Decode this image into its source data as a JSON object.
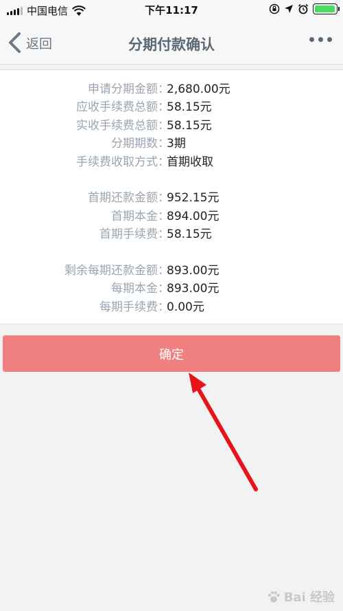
{
  "status_bar": {
    "carrier": "中国电信",
    "time": "下午11:17",
    "battery_level": 0.95
  },
  "nav": {
    "back_label": "返回",
    "title": "分期付款确认"
  },
  "details": {
    "separator": "：",
    "groups": [
      [
        {
          "label": "申请分期金额",
          "value": "2,680.00元"
        },
        {
          "label": "应收手续费总额",
          "value": "58.15元"
        },
        {
          "label": "实收手续费总额",
          "value": "58.15元"
        },
        {
          "label": "分期期数",
          "value": "3期"
        },
        {
          "label": "手续费收取方式",
          "value": "首期收取"
        }
      ],
      [
        {
          "label": "首期还款金额",
          "value": "952.15元"
        },
        {
          "label": "首期本金",
          "value": "894.00元"
        },
        {
          "label": "首期手续费",
          "value": "58.15元"
        }
      ],
      [
        {
          "label": "剩余每期还款金额",
          "value": "893.00元"
        },
        {
          "label": "每期本金",
          "value": "893.00元"
        },
        {
          "label": "每期手续费",
          "value": "0.00元"
        }
      ]
    ]
  },
  "confirm_label": "确定",
  "colors": {
    "confirm_button": "#f08080",
    "annotation_arrow": "#e8141c",
    "label_text": "#9aa5b1"
  },
  "watermark": {
    "text": "Bai 经验"
  }
}
